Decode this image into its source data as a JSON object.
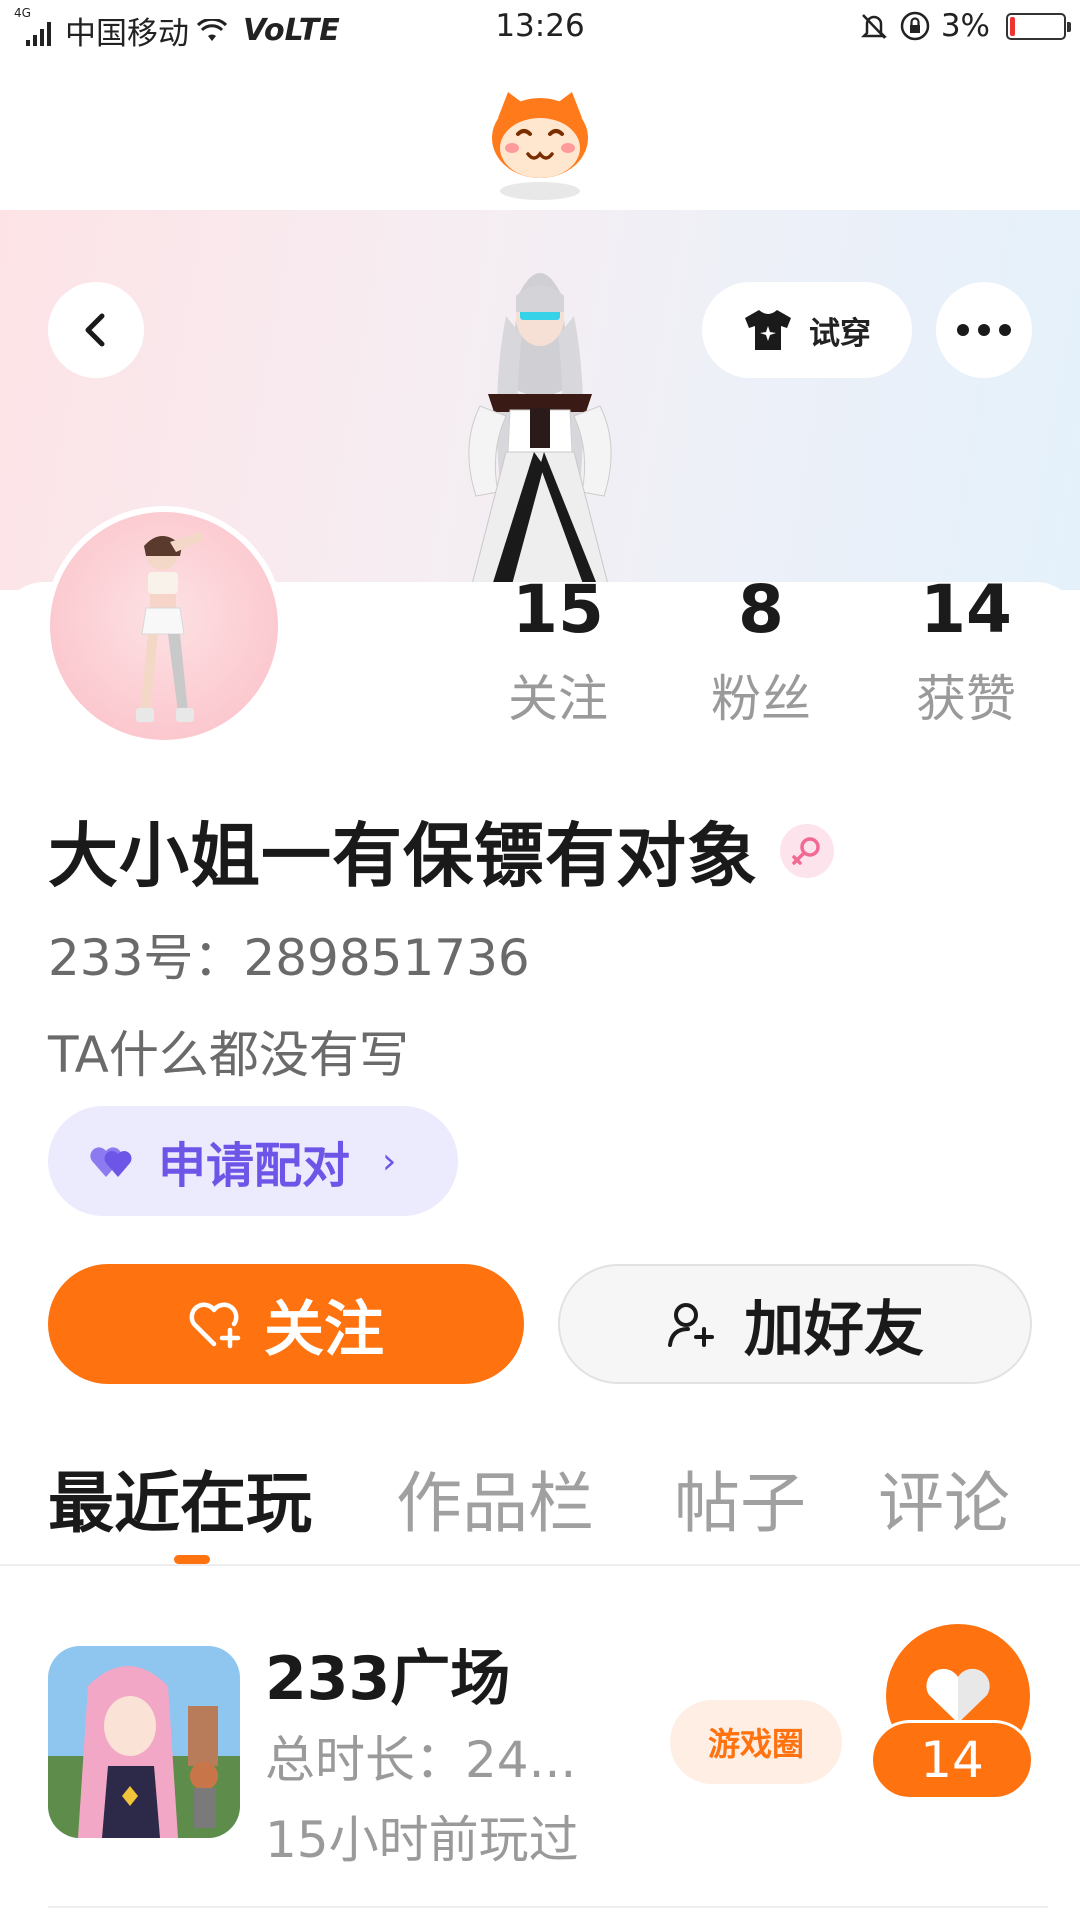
{
  "status_bar": {
    "network": "4G",
    "carrier": "中国移动",
    "volte": "VoLTE",
    "time": "13:26",
    "battery": "3%"
  },
  "header": {
    "tryon_label": "试穿"
  },
  "stats": [
    {
      "value": "15",
      "label": "关注"
    },
    {
      "value": "8",
      "label": "粉丝"
    },
    {
      "value": "14",
      "label": "获赞"
    }
  ],
  "profile": {
    "name": "大小姐一有保镖有对象",
    "uid": "233号：289851736",
    "bio": "TA什么都没有写"
  },
  "actions": {
    "pair_label": "申请配对",
    "follow_label": "关注",
    "add_friend_label": "加好友"
  },
  "tabs": [
    {
      "label": "最近在玩",
      "active": true
    },
    {
      "label": "作品栏",
      "active": false
    },
    {
      "label": "帖子",
      "active": false
    },
    {
      "label": "评论",
      "active": false
    }
  ],
  "games": [
    {
      "name": "233广场",
      "playtime": "总时长：24...",
      "last_played": "15小时前玩过",
      "circle_label": "游戏圈",
      "likes": "14"
    }
  ],
  "colors": {
    "accent": "#ff7210",
    "pair_purple": "#6d55e8",
    "pair_bg": "#ecebfd",
    "text_primary": "#1a1a1a",
    "text_secondary": "#9a9a9a"
  }
}
